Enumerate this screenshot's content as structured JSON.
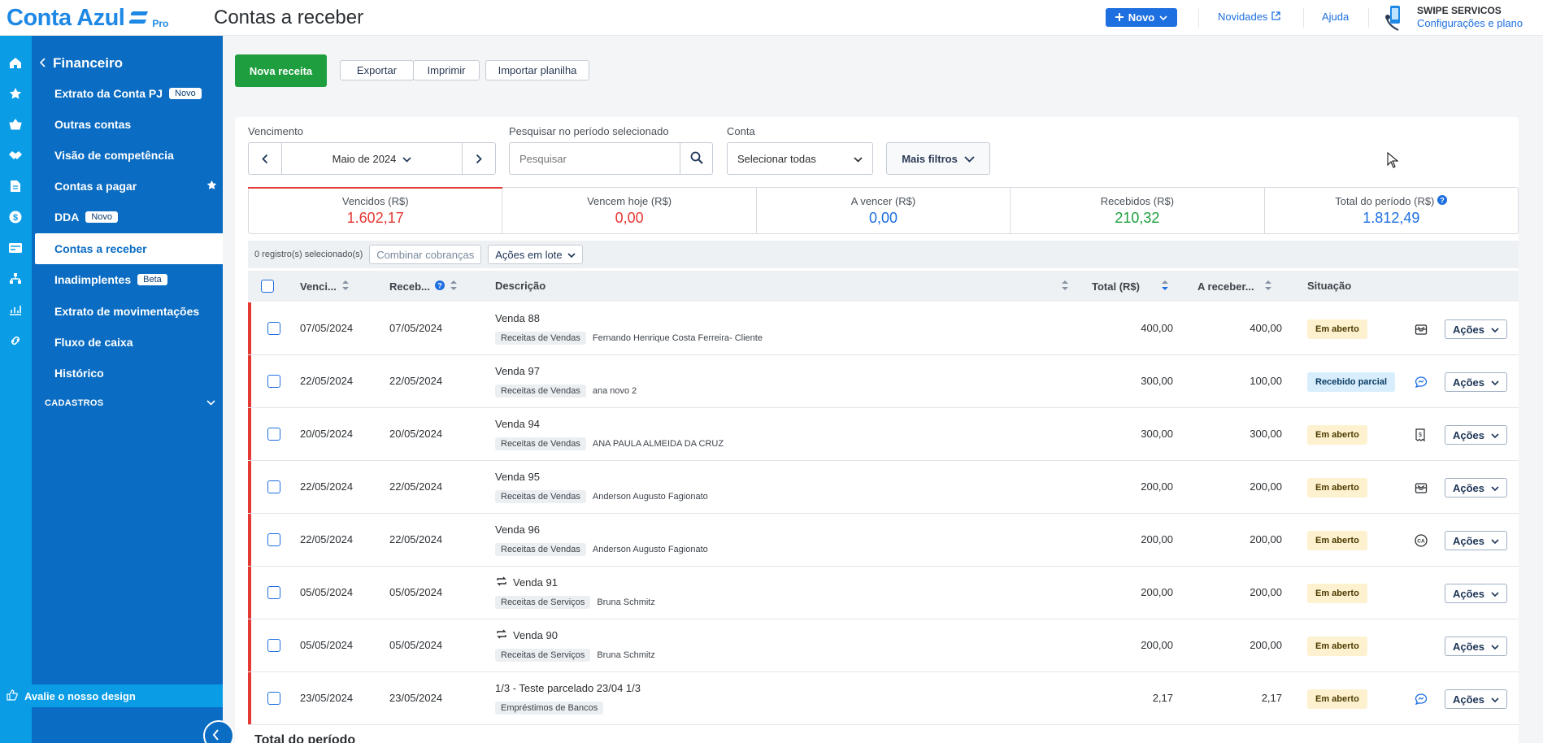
{
  "header": {
    "brand": "Conta Azul",
    "brand_tier": "Pro",
    "page_title": "Contas a receber",
    "novo_label": "Novo",
    "novidades_label": "Novidades",
    "ajuda_label": "Ajuda",
    "account_name": "SWIPE SERVICOS",
    "account_link": "Configurações e plano"
  },
  "sidebar": {
    "back_label": "Financeiro",
    "items": [
      {
        "label": "Extrato da Conta PJ",
        "tag": "Novo"
      },
      {
        "label": "Outras contas"
      },
      {
        "label": "Visão de competência"
      },
      {
        "label": "Contas a pagar"
      },
      {
        "label": "DDA",
        "tag": "Novo"
      },
      {
        "label": "Contas a receber"
      },
      {
        "label": "Inadimplentes",
        "tag": "Beta"
      },
      {
        "label": "Extrato de movimentações"
      },
      {
        "label": "Fluxo de caixa"
      },
      {
        "label": "Histórico"
      }
    ],
    "section_label": "CADASTROS",
    "footer_label": "Avalie o nosso design"
  },
  "actions": {
    "nova_receita": "Nova receita",
    "exportar": "Exportar",
    "imprimir": "Imprimir",
    "importar": "Importar planilha"
  },
  "filters": {
    "vencimento_label": "Vencimento",
    "period_value": "Maio de 2024",
    "search_label": "Pesquisar no período selecionado",
    "search_placeholder": "Pesquisar",
    "conta_label": "Conta",
    "conta_value": "Selecionar todas",
    "mais_filtros": "Mais filtros"
  },
  "summary": [
    {
      "label": "Vencidos (R$)",
      "value": "1.602,17",
      "color": "#e53935"
    },
    {
      "label": "Vencem hoje (R$)",
      "value": "0,00",
      "color": "#e53935"
    },
    {
      "label": "A vencer (R$)",
      "value": "0,00",
      "color": "#1e6fe0"
    },
    {
      "label": "Recebidos (R$)",
      "value": "210,32",
      "color": "#1e9e3e"
    },
    {
      "label": "Total do período (R$)",
      "value": "1.812,49",
      "color": "#1e6fe0"
    }
  ],
  "bulk": {
    "selected_text": "0 registro(s) selecionado(s)",
    "combinar": "Combinar cobranças",
    "acoes_lote": "Ações em lote"
  },
  "table": {
    "columns": {
      "vencimento": "Venci...",
      "recebimento": "Receb...",
      "descricao": "Descrição",
      "total": "Total (R$)",
      "a_receber": "A receber...",
      "situacao": "Situação"
    },
    "action_label": "Ações",
    "rows": [
      {
        "venc": "07/05/2024",
        "receb": "07/05/2024",
        "desc": "Venda 88",
        "cat": "Receitas de Vendas",
        "client": "Fernando Henrique Costa Ferreira- Cliente",
        "total": "400,00",
        "a_receber": "400,00",
        "status": "Em aberto",
        "icon": "envelope-icon"
      },
      {
        "venc": "22/05/2024",
        "receb": "22/05/2024",
        "desc": "Venda 97",
        "cat": "Receitas de Vendas",
        "client": "ana novo 2",
        "total": "300,00",
        "a_receber": "100,00",
        "status": "Recebido parcial",
        "icon": "chat-icon"
      },
      {
        "venc": "20/05/2024",
        "receb": "20/05/2024",
        "desc": "Venda 94",
        "cat": "Receitas de Vendas",
        "client": "ANA PAULA ALMEIDA DA CRUZ",
        "total": "300,00",
        "a_receber": "300,00",
        "status": "Em aberto",
        "icon": "invoice-icon"
      },
      {
        "venc": "22/05/2024",
        "receb": "22/05/2024",
        "desc": "Venda 95",
        "cat": "Receitas de Vendas",
        "client": "Anderson Augusto Fagionato",
        "total": "200,00",
        "a_receber": "200,00",
        "status": "Em aberto",
        "icon": "envelope-icon"
      },
      {
        "venc": "22/05/2024",
        "receb": "22/05/2024",
        "desc": "Venda 96",
        "cat": "Receitas de Vendas",
        "client": "Anderson Augusto Fagionato",
        "total": "200,00",
        "a_receber": "200,00",
        "status": "Em aberto",
        "icon": "ca-icon"
      },
      {
        "venc": "05/05/2024",
        "receb": "05/05/2024",
        "desc": "Venda 91",
        "cat": "Receitas de Serviços",
        "client": "Bruna Schmitz",
        "total": "200,00",
        "a_receber": "200,00",
        "status": "Em aberto",
        "icon": "",
        "recurring": true
      },
      {
        "venc": "05/05/2024",
        "receb": "05/05/2024",
        "desc": "Venda 90",
        "cat": "Receitas de Serviços",
        "client": "Bruna Schmitz",
        "total": "200,00",
        "a_receber": "200,00",
        "status": "Em aberto",
        "icon": "",
        "recurring": true
      },
      {
        "venc": "23/05/2024",
        "receb": "23/05/2024",
        "desc": "1/3 - Teste parcelado 23/04 1/3",
        "cat": "Empréstimos de Bancos",
        "client": "",
        "total": "2,17",
        "a_receber": "2,17",
        "status": "Em aberto",
        "icon": "chat-icon"
      }
    ]
  },
  "footer_partial_title": "Total do período"
}
